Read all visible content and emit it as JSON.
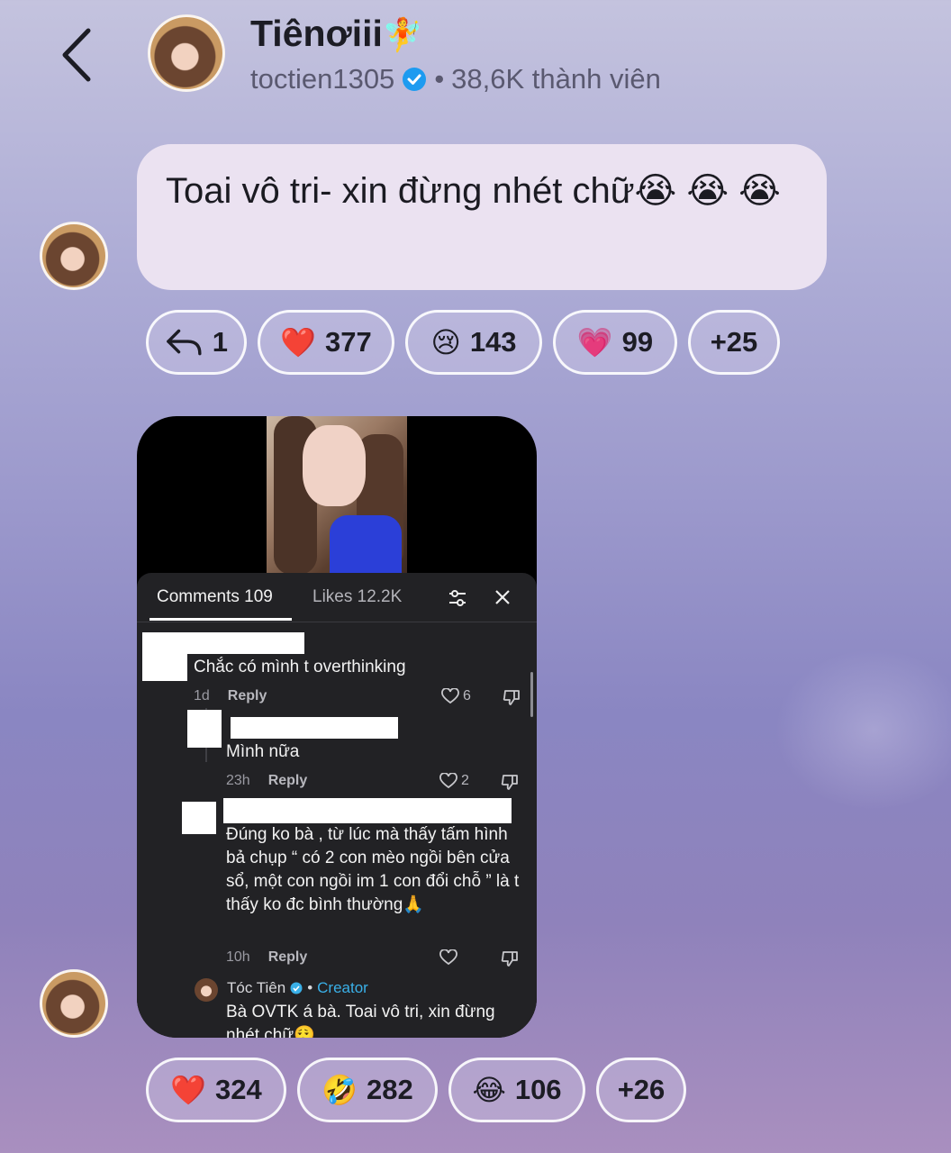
{
  "header": {
    "title": "Tiênơiii",
    "title_emoji": "🧚",
    "username": "toctien1305",
    "separator": "•",
    "member_count": "38,6K thành viên"
  },
  "post1": {
    "text": "Toai vô tri- xin đừng nhét chữ😭 😭 😭",
    "reactions": [
      {
        "icon": "reply-icon",
        "count": "1"
      },
      {
        "emoji": "❤️",
        "count": "377"
      },
      {
        "emoji": "😢",
        "count": "143"
      },
      {
        "emoji": "💗",
        "count": "99"
      },
      {
        "count": "+25"
      }
    ]
  },
  "post2": {
    "screenshot": {
      "tabs": {
        "comments": "Comments 109",
        "likes": "Likes 12.2K"
      },
      "comments": [
        {
          "text": "Chắc có mình t overthinking",
          "time": "1d",
          "reply": "Reply",
          "likes": "6"
        },
        {
          "text": "Mình nữa",
          "time": "23h",
          "reply": "Reply",
          "likes": "2"
        },
        {
          "text": "Đúng ko bà , từ lúc mà thấy tấm hình bả chụp “ có 2 con mèo ngồi bên cửa sổ, một con ngồi im 1 con đổi chỗ ” là t thấy ko đc bình thường🙏",
          "time": "10h",
          "reply": "Reply",
          "likes": ""
        },
        {
          "author": "Tóc Tiên",
          "badge": "Creator",
          "text": "Bà OVTK á bà. Toai vô tri, xin đừng nhét chữ😮‍💨"
        }
      ]
    },
    "reactions": [
      {
        "emoji": "❤️",
        "count": "324"
      },
      {
        "emoji": "🤣",
        "count": "282"
      },
      {
        "emoji": "😂",
        "count": "106"
      },
      {
        "count": "+26"
      }
    ]
  },
  "colors": {
    "verified": "#1d9bf0",
    "creator": "#3ab0e8"
  }
}
